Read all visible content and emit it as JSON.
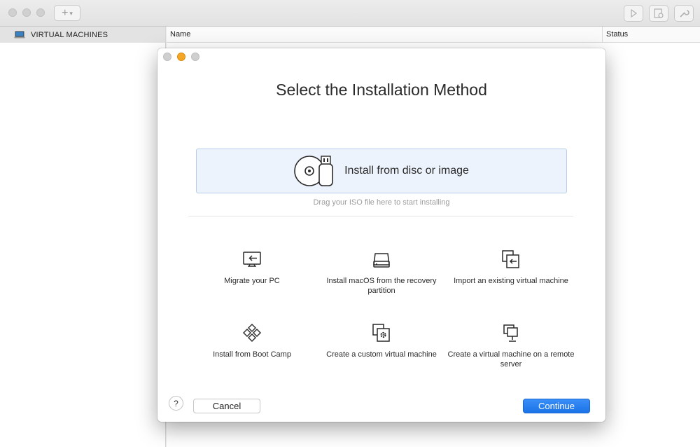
{
  "sidebar": {
    "header_label": "VIRTUAL MACHINES",
    "header_icon": "laptop-icon"
  },
  "table": {
    "columns": [
      "Name",
      "Status"
    ]
  },
  "toolbar": {
    "add_icon": "plus-icon",
    "right_icons": [
      "play-icon",
      "snapshot-icon",
      "wrench-icon"
    ]
  },
  "dialog": {
    "title": "Select the Installation Method",
    "drop_zone": {
      "label": "Install from disc or image",
      "hint": "Drag your ISO file here to start installing",
      "icon": "disc-usb-icon"
    },
    "options": [
      {
        "label": "Migrate your PC",
        "icon": "migrate-pc-icon"
      },
      {
        "label": "Install macOS from the recovery partition",
        "icon": "hard-drive-icon"
      },
      {
        "label": "Import an existing virtual machine",
        "icon": "import-vm-icon"
      },
      {
        "label": "Install from Boot Camp",
        "icon": "boot-camp-icon"
      },
      {
        "label": "Create a custom virtual machine",
        "icon": "custom-vm-icon"
      },
      {
        "label": "Create a virtual machine on a remote server",
        "icon": "remote-server-icon"
      }
    ],
    "help_label": "?",
    "cancel_label": "Cancel",
    "continue_label": "Continue"
  },
  "colors": {
    "accent": "#1a73e8",
    "drop_zone_bg": "#edf3fc",
    "traffic_minimize": "#f5a623"
  }
}
